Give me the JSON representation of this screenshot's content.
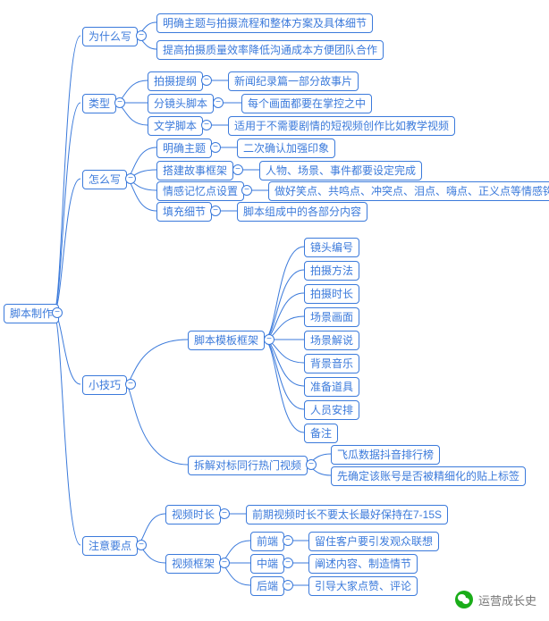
{
  "root": {
    "label": "脚本制作"
  },
  "branches": {
    "why": {
      "label": "为什么写",
      "children": [
        "明确主题与拍摄流程和整体方案及具体细节",
        "提高拍摄质量效率降低沟通成本方便团队合作"
      ]
    },
    "type": {
      "label": "类型",
      "children": [
        {
          "label": "拍摄提纲",
          "note": "新闻纪录篇一部分故事片"
        },
        {
          "label": "分镜头脚本",
          "note": "每个画面都要在掌控之中"
        },
        {
          "label": "文学脚本",
          "note": "适用于不需要剧情的短视频创作比如教学视频"
        }
      ]
    },
    "how": {
      "label": "怎么写",
      "children": [
        {
          "label": "明确主题",
          "note": "二次确认加强印象"
        },
        {
          "label": "搭建故事框架",
          "note": "人物、场景、事件都要设定完成"
        },
        {
          "label": "情感记忆点设置",
          "note": "做好笑点、共鸣点、冲突点、泪点、嗨点、正义点等情感钩子"
        },
        {
          "label": "填充细节",
          "note": "脚本组成中的各部分内容"
        }
      ]
    },
    "tips": {
      "label": "小技巧",
      "template": {
        "label": "脚本模板框架",
        "items": [
          "镜头编号",
          "拍摄方法",
          "拍摄时长",
          "场景画面",
          "场景解说",
          "背景音乐",
          "准备道具",
          "人员安排",
          "备注"
        ]
      },
      "benchmark": {
        "label": "拆解对标同行热门视频",
        "items": [
          "飞瓜数据抖音排行榜",
          "先确定该账号是否被精细化的贴上标签"
        ]
      }
    },
    "notes": {
      "label": "注意要点",
      "duration": {
        "label": "视频时长",
        "note": "前期视频时长不要太长最好保持在7-15S"
      },
      "frame": {
        "label": "视频框架",
        "children": [
          {
            "label": "前端",
            "note": "留住客户要引发观众联想"
          },
          {
            "label": "中端",
            "note": "阐述内容、制造情节"
          },
          {
            "label": "后端",
            "note": "引导大家点赞、评论"
          }
        ]
      }
    }
  },
  "watermark": "运营成长史",
  "chart_data": {
    "type": "mindmap",
    "title": "脚本制作",
    "root": "脚本制作",
    "children": [
      {
        "label": "为什么写",
        "children": [
          "明确主题与拍摄流程和整体方案及具体细节",
          "提高拍摄质量效率降低沟通成本方便团队合作"
        ]
      },
      {
        "label": "类型",
        "children": [
          {
            "label": "拍摄提纲",
            "children": [
              "新闻纪录篇一部分故事片"
            ]
          },
          {
            "label": "分镜头脚本",
            "children": [
              "每个画面都要在掌控之中"
            ]
          },
          {
            "label": "文学脚本",
            "children": [
              "适用于不需要剧情的短视频创作比如教学视频"
            ]
          }
        ]
      },
      {
        "label": "怎么写",
        "children": [
          {
            "label": "明确主题",
            "children": [
              "二次确认加强印象"
            ]
          },
          {
            "label": "搭建故事框架",
            "children": [
              "人物、场景、事件都要设定完成"
            ]
          },
          {
            "label": "情感记忆点设置",
            "children": [
              "做好笑点、共鸣点、冲突点、泪点、嗨点、正义点等情感钩子"
            ]
          },
          {
            "label": "填充细节",
            "children": [
              "脚本组成中的各部分内容"
            ]
          }
        ]
      },
      {
        "label": "小技巧",
        "children": [
          {
            "label": "脚本模板框架",
            "children": [
              "镜头编号",
              "拍摄方法",
              "拍摄时长",
              "场景画面",
              "场景解说",
              "背景音乐",
              "准备道具",
              "人员安排",
              "备注"
            ]
          },
          {
            "label": "拆解对标同行热门视频",
            "children": [
              "飞瓜数据抖音排行榜",
              "先确定该账号是否被精细化的贴上标签"
            ]
          }
        ]
      },
      {
        "label": "注意要点",
        "children": [
          {
            "label": "视频时长",
            "children": [
              "前期视频时长不要太长最好保持在7-15S"
            ]
          },
          {
            "label": "视频框架",
            "children": [
              {
                "label": "前端",
                "children": [
                  "留住客户要引发观众联想"
                ]
              },
              {
                "label": "中端",
                "children": [
                  "阐述内容、制造情节"
                ]
              },
              {
                "label": "后端",
                "children": [
                  "引导大家点赞、评论"
                ]
              }
            ]
          }
        ]
      }
    ]
  }
}
